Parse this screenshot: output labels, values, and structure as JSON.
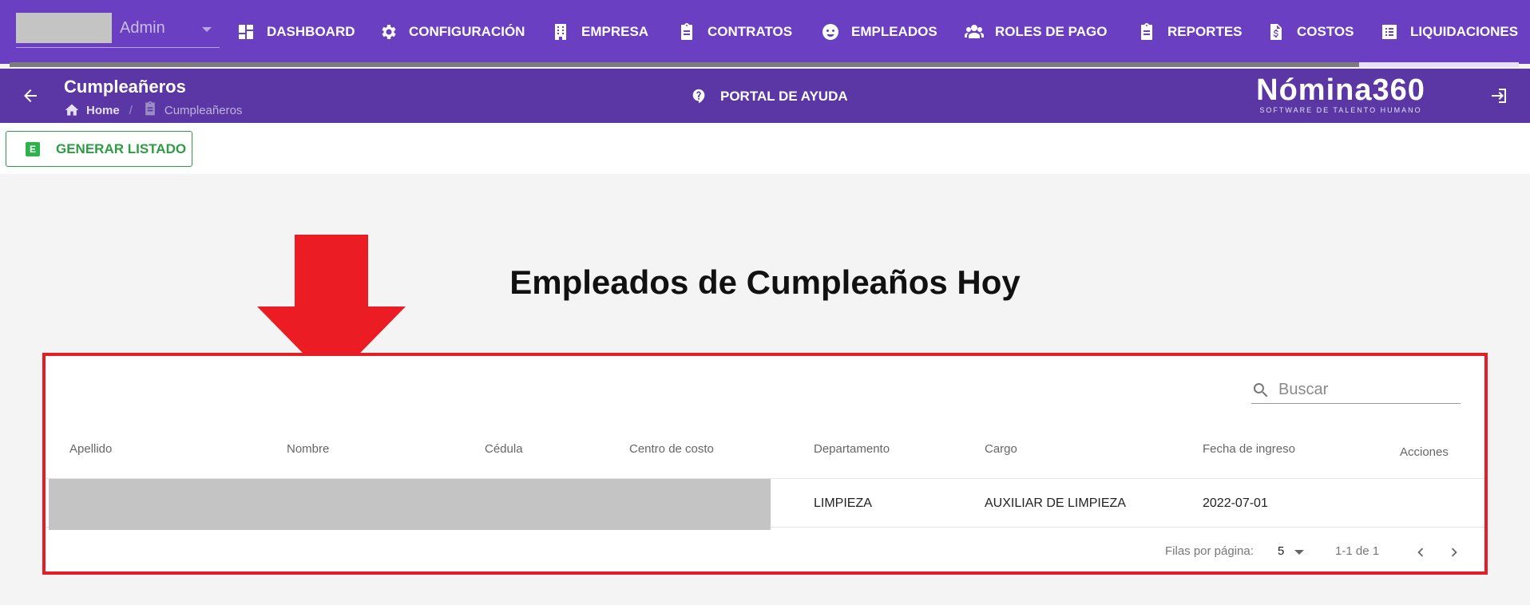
{
  "topnav": {
    "user": "Admin",
    "items": [
      {
        "label": "DASHBOARD",
        "icon": "dashboard-icon"
      },
      {
        "label": "CONFIGURACIÓN",
        "icon": "gear-icon"
      },
      {
        "label": "EMPRESA",
        "icon": "building-icon"
      },
      {
        "label": "CONTRATOS",
        "icon": "clipboard-icon"
      },
      {
        "label": "EMPLEADOS",
        "icon": "face-icon"
      },
      {
        "label": "ROLES DE PAGO",
        "icon": "people-icon"
      },
      {
        "label": "REPORTES",
        "icon": "clipboard-icon"
      },
      {
        "label": "COSTOS",
        "icon": "dollar-document-icon"
      },
      {
        "label": "LIQUIDACIONES",
        "icon": "list-icon"
      }
    ]
  },
  "subheader": {
    "title": "Cumpleañeros",
    "breadcrumb": {
      "home": "Home",
      "current": "Cumpleañeros"
    },
    "help": "PORTAL DE AYUDA",
    "brand": {
      "logo": "Nómina360",
      "tagline": "SOFTWARE DE TALENTO HUMANO"
    }
  },
  "actions": {
    "generate": "GENERAR LISTADO",
    "badge": "E"
  },
  "main": {
    "title": "Empleados de Cumpleaños Hoy"
  },
  "colors": {
    "nav": "#6a3fc1",
    "subnav": "#5a37a4",
    "accent_green": "#2e9b45",
    "highlight_red": "#e31e24"
  },
  "table": {
    "search_placeholder": "Buscar",
    "columns": [
      "Apellido",
      "Nombre",
      "Cédula",
      "Centro de costo",
      "Departamento",
      "Cargo",
      "Fecha de ingreso",
      "Acciones"
    ],
    "rows": [
      {
        "departamento": "LIMPIEZA",
        "cargo": "AUXILIAR DE LIMPIEZA",
        "fecha_ingreso": "2022-07-01"
      }
    ],
    "pagination": {
      "rows_label": "Filas por página:",
      "rows_per_page": "5",
      "range": "1-1 de 1"
    }
  }
}
